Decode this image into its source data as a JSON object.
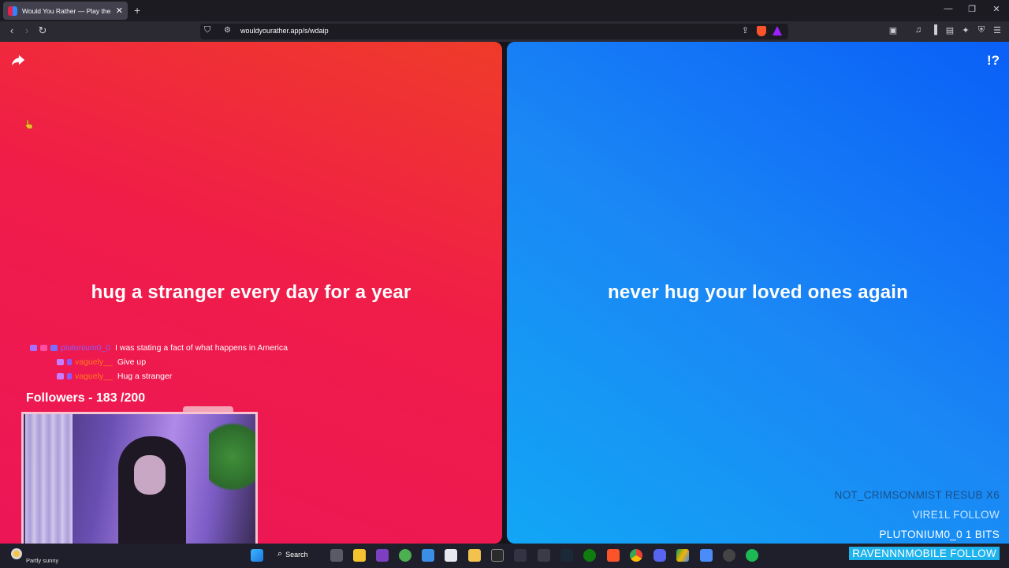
{
  "browser": {
    "tab_title": "Would You Rather — Play the O",
    "url": "wouldyourather.app/s/wdaip"
  },
  "game": {
    "option_red": "hug a stranger every day for a year",
    "option_blue": "never hug your loved ones again",
    "help_label": "!?"
  },
  "stream": {
    "chat": [
      {
        "user": "plutonium0_0",
        "message": "I was stating a fact of what happens in America"
      },
      {
        "user": "vaguely__",
        "message": "Give up"
      },
      {
        "user": "vaguely__",
        "message": "Hug a stranger"
      }
    ],
    "followers_goal": "Followers - 183 /200",
    "alerts": [
      "NOT_CRIMSONMIST  RESUB X6",
      "VIRE1L  FOLLOW",
      "PLUTONIUM0_0  1 BITS",
      "RAVENNNMOBILE  FOLLOW"
    ]
  },
  "taskbar": {
    "weather": "Partly sunny",
    "search_label": "Search"
  },
  "colors": {
    "red_panel": "#ef1f4c",
    "blue_panel": "#1a86f5",
    "alert_highlight": "#1fb3ee"
  }
}
